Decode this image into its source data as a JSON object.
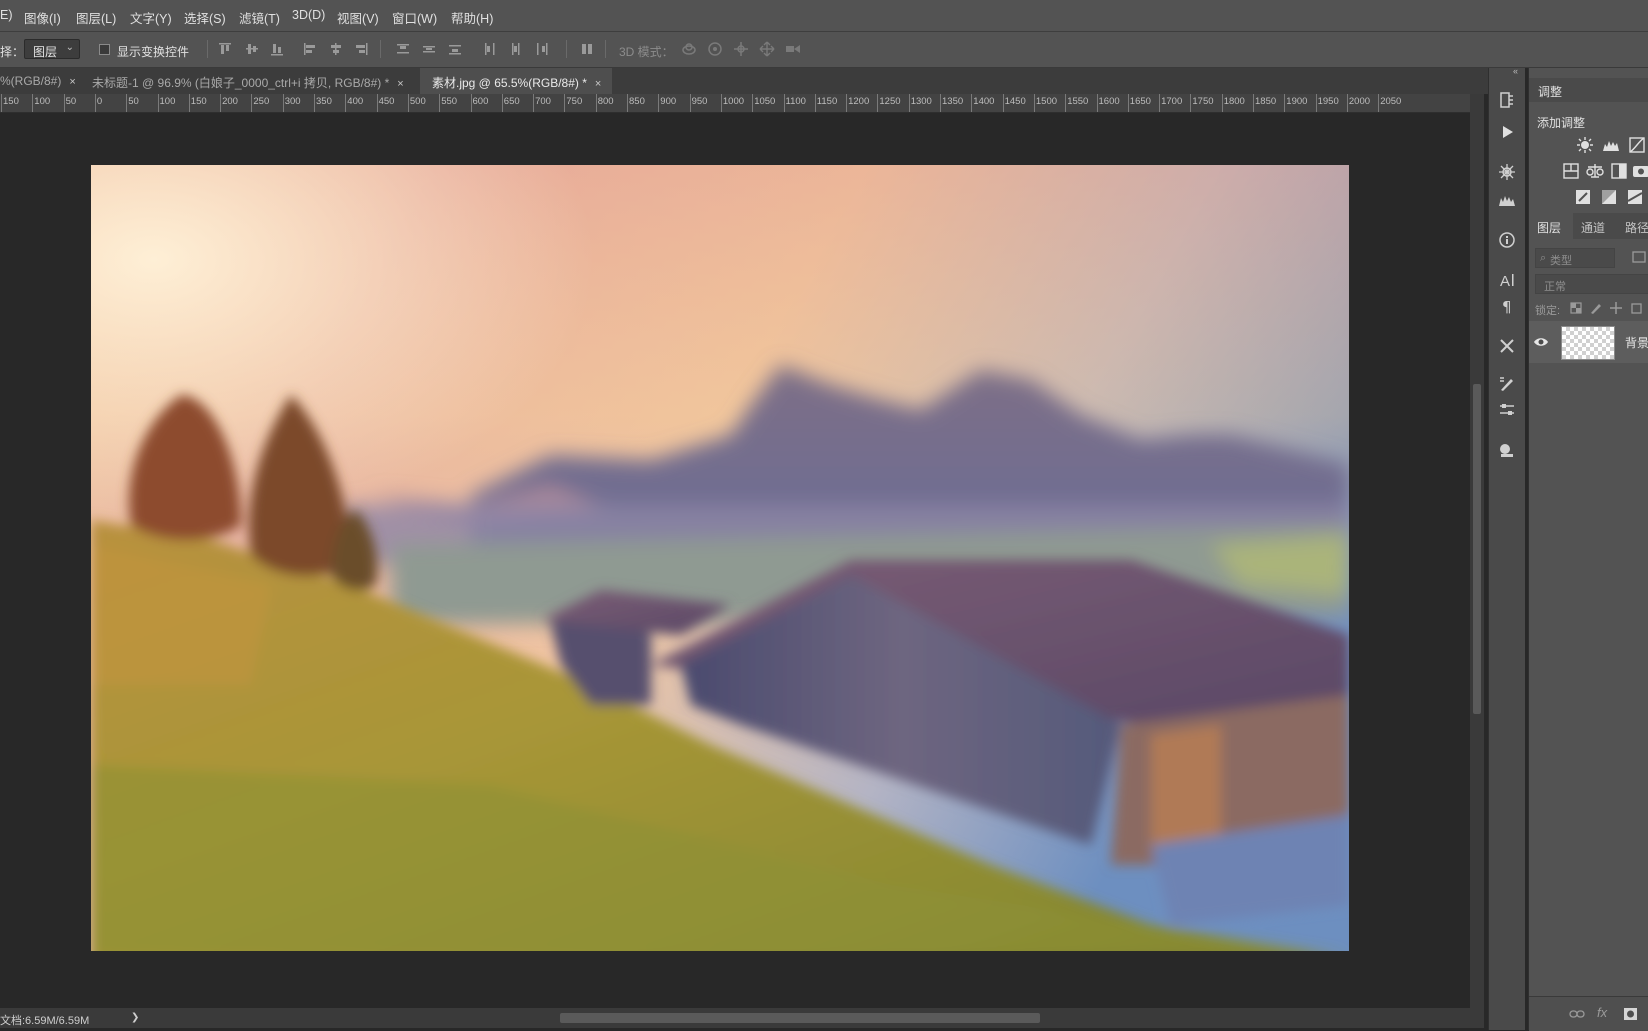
{
  "menu": [
    "E)",
    "图像(I)",
    "图层(L)",
    "文字(Y)",
    "选择(S)",
    "滤镜(T)",
    "3D(D)",
    "视图(V)",
    "窗口(W)",
    "帮助(H)"
  ],
  "options": {
    "select_label": "择：",
    "target_value": "图层",
    "show_transform_label": "显示变换控件",
    "mode_3d_label": "3D 模式："
  },
  "tabs": [
    {
      "label": "%(RGB/8#)",
      "close": "×",
      "active": false
    },
    {
      "label": "未标题-1 @ 96.9% (白娘子_0000_ctrl+i 拷贝, RGB/8#) *",
      "close": "×",
      "active": false
    },
    {
      "label": "素材.jpg @ 65.5%(RGB/8#) *",
      "close": "×",
      "active": true
    }
  ],
  "ruler_labels": [
    "150",
    "100",
    "50",
    "0",
    "50",
    "100",
    "150",
    "200",
    "250",
    "300",
    "350",
    "400",
    "450",
    "500",
    "550",
    "600",
    "650",
    "700",
    "750",
    "800",
    "850",
    "900",
    "950",
    "1000",
    "1050",
    "1100",
    "1150",
    "1200",
    "1250",
    "1300",
    "1350",
    "1400",
    "1450",
    "1500",
    "1550",
    "1600",
    "1650",
    "1700",
    "1750",
    "1800",
    "1850",
    "1900",
    "1950",
    "2000",
    "2050"
  ],
  "status": {
    "doc_info": "文档:6.59M/6.59M",
    "arrow": "❯"
  },
  "panels": {
    "adjust_tab": "调整",
    "add_adjust": "添加调整",
    "layers_tab": "图层",
    "channels_tab": "通道",
    "paths_tab": "路径",
    "filter_kind": "类型",
    "blend_mode": "正常",
    "lock_label": "锁定:",
    "layer_name": "背景"
  },
  "icons": {
    "collapse": "collapse-icon",
    "history": "history-icon",
    "play": "play-icon",
    "gear": "settings-icon",
    "info": "info-icon",
    "character": "character-icon",
    "paragraph": "paragraph-icon",
    "tools": "tool-presets-icon",
    "brush": "brush-icon",
    "properties": "properties-icon",
    "clone": "clone-source-icon",
    "eye": "eye-icon"
  },
  "colors": {
    "ui_bg": "#535353",
    "canvas_bg": "#282828",
    "panel_dark": "#3a3a3a"
  }
}
